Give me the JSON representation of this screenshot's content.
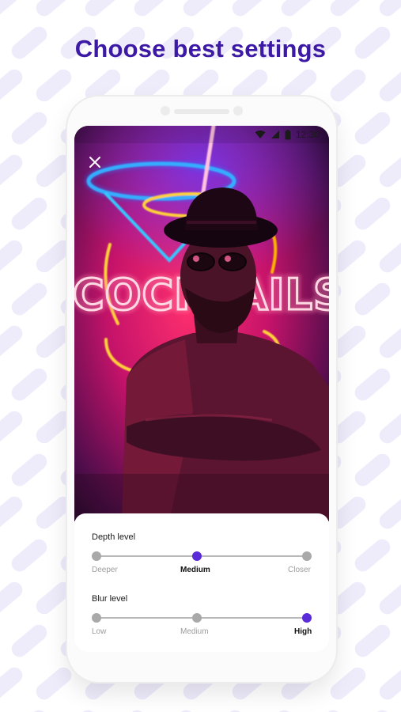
{
  "headline": "Choose best settings",
  "status_bar": {
    "time": "12:30",
    "icons": [
      "wifi-icon",
      "signal-icon",
      "battery-icon"
    ]
  },
  "photo": {
    "neon_text": "COCKTAILS",
    "description_icon": "neon-cocktail-photo"
  },
  "close_icon": "close-icon",
  "colors": {
    "accent": "#5a2bd8",
    "headline": "#3d1aa5",
    "inactive_stop": "#a9a9a9"
  },
  "settings": {
    "depth": {
      "title": "Depth level",
      "options": [
        "Deeper",
        "Medium",
        "Closer"
      ],
      "selected_index": 1
    },
    "blur": {
      "title": "Blur level",
      "options": [
        "Low",
        "Medium",
        "High"
      ],
      "selected_index": 2
    }
  }
}
